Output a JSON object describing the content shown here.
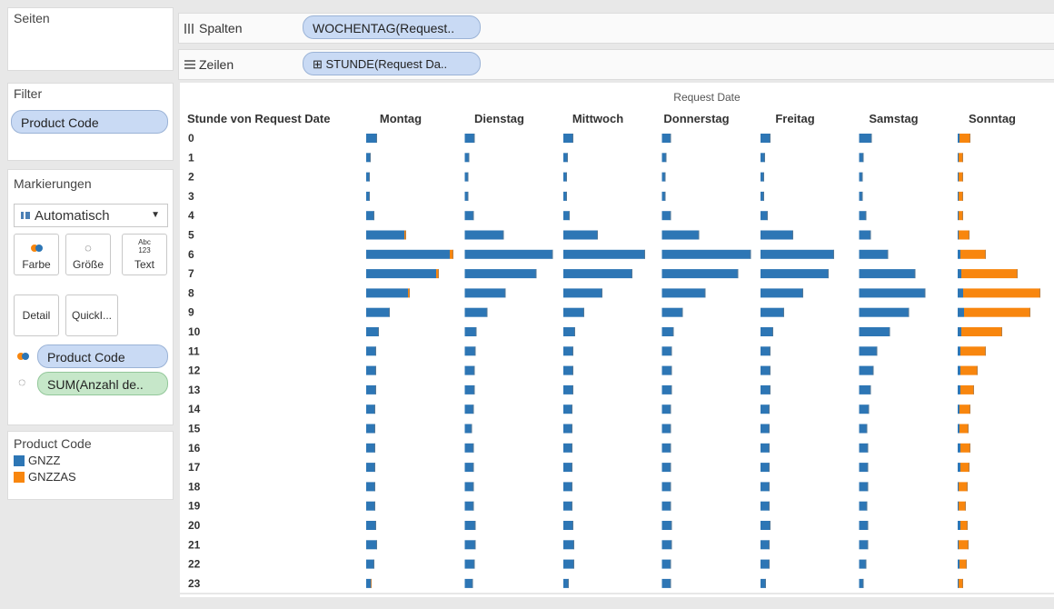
{
  "pages_panel": {
    "title": "Seiten"
  },
  "filter_panel": {
    "title": "Filter",
    "pill": "Product Code"
  },
  "marks_panel": {
    "title": "Markierungen",
    "mark_type": "Automatisch",
    "cards": {
      "color": "Farbe",
      "size": "Größe",
      "text_icon": "Abc\n123",
      "text": "Text",
      "detail": "Detail",
      "tooltip": "QuickI..."
    },
    "color_pill": "Product Code",
    "size_pill": "SUM(Anzahl de.."
  },
  "legend": {
    "title": "Product Code",
    "items": [
      {
        "label": "GNZZ",
        "color": "#2d76b5"
      },
      {
        "label": "GNZZAS",
        "color": "#f8860e"
      }
    ]
  },
  "shelves": {
    "columns_label": "Spalten",
    "columns_pill": "WOCHENTAG(Request..",
    "rows_label": "Zeilen",
    "rows_pill": "⊞ STUNDE(Request Da.."
  },
  "chart_data": {
    "type": "bar",
    "title": "Request Date",
    "row_header": "Stunde von Request Date",
    "days": [
      "Montag",
      "Dienstag",
      "Mittwoch",
      "Donnerstag",
      "Freitag",
      "Samstag",
      "Sonntag"
    ],
    "hours": [
      "0",
      "1",
      "2",
      "3",
      "4",
      "5",
      "6",
      "7",
      "8",
      "9",
      "10",
      "11",
      "12",
      "13",
      "14",
      "15",
      "16",
      "17",
      "18",
      "19",
      "20",
      "21",
      "22",
      "23"
    ],
    "series": [
      {
        "name": "GNZZ",
        "color": "#2d76b5",
        "values": [
          [
            12,
            5,
            4,
            4,
            9,
            42,
            92,
            77,
            46,
            26,
            14,
            11,
            11,
            11,
            10,
            10,
            10,
            10,
            10,
            10,
            11,
            12,
            9,
            5
          ],
          [
            11,
            5,
            4,
            4,
            10,
            43,
            97,
            79,
            45,
            25,
            13,
            12,
            11,
            11,
            10,
            8,
            10,
            10,
            10,
            10,
            12,
            12,
            11,
            9
          ],
          [
            11,
            5,
            4,
            4,
            7,
            38,
            90,
            76,
            43,
            23,
            13,
            11,
            11,
            11,
            10,
            10,
            10,
            10,
            10,
            10,
            11,
            12,
            12,
            6
          ],
          [
            10,
            5,
            4,
            4,
            10,
            41,
            98,
            84,
            48,
            23,
            13,
            11,
            11,
            11,
            10,
            10,
            10,
            10,
            10,
            10,
            11,
            11,
            10,
            10
          ],
          [
            11,
            5,
            4,
            4,
            8,
            36,
            81,
            75,
            47,
            26,
            14,
            11,
            11,
            11,
            10,
            10,
            10,
            10,
            10,
            10,
            11,
            10,
            10,
            6
          ],
          [
            14,
            5,
            4,
            4,
            8,
            13,
            32,
            62,
            73,
            55,
            34,
            20,
            16,
            13,
            11,
            9,
            10,
            10,
            10,
            9,
            10,
            10,
            8,
            5
          ],
          [
            2,
            1,
            1,
            1,
            1,
            1,
            3,
            4,
            6,
            7,
            4,
            3,
            3,
            3,
            2,
            2,
            3,
            3,
            1,
            1,
            3,
            1,
            2,
            1
          ]
        ]
      },
      {
        "name": "GNZZAS",
        "color": "#f8860e",
        "values": [
          [
            0,
            0,
            0,
            0,
            0,
            2,
            4,
            3,
            2,
            0,
            0,
            0,
            0,
            0,
            0,
            0,
            0,
            0,
            0,
            0,
            0,
            0,
            0,
            1
          ],
          [
            0,
            0,
            0,
            0,
            0,
            0,
            0,
            0,
            0,
            0,
            0,
            0,
            0,
            0,
            0,
            0,
            0,
            0,
            0,
            0,
            0,
            0,
            0,
            0
          ],
          [
            0,
            0,
            0,
            0,
            0,
            0,
            0,
            0,
            0,
            0,
            0,
            0,
            0,
            0,
            0,
            0,
            0,
            0,
            0,
            0,
            0,
            0,
            0,
            0
          ],
          [
            0,
            0,
            0,
            0,
            0,
            0,
            0,
            0,
            0,
            0,
            0,
            0,
            0,
            0,
            0,
            0,
            0,
            0,
            0,
            0,
            0,
            0,
            0,
            0
          ],
          [
            0,
            0,
            0,
            0,
            0,
            0,
            0,
            0,
            0,
            0,
            0,
            0,
            0,
            0,
            0,
            0,
            0,
            0,
            0,
            0,
            0,
            0,
            0,
            0
          ],
          [
            0,
            0,
            0,
            0,
            0,
            0,
            0,
            0,
            0,
            0,
            0,
            0,
            0,
            0,
            0,
            0,
            0,
            0,
            0,
            0,
            0,
            0,
            0,
            0
          ],
          [
            12,
            5,
            5,
            5,
            5,
            12,
            28,
            62,
            85,
            73,
            45,
            28,
            19,
            15,
            12,
            10,
            11,
            10,
            10,
            8,
            8,
            11,
            8,
            5
          ]
        ]
      }
    ]
  }
}
